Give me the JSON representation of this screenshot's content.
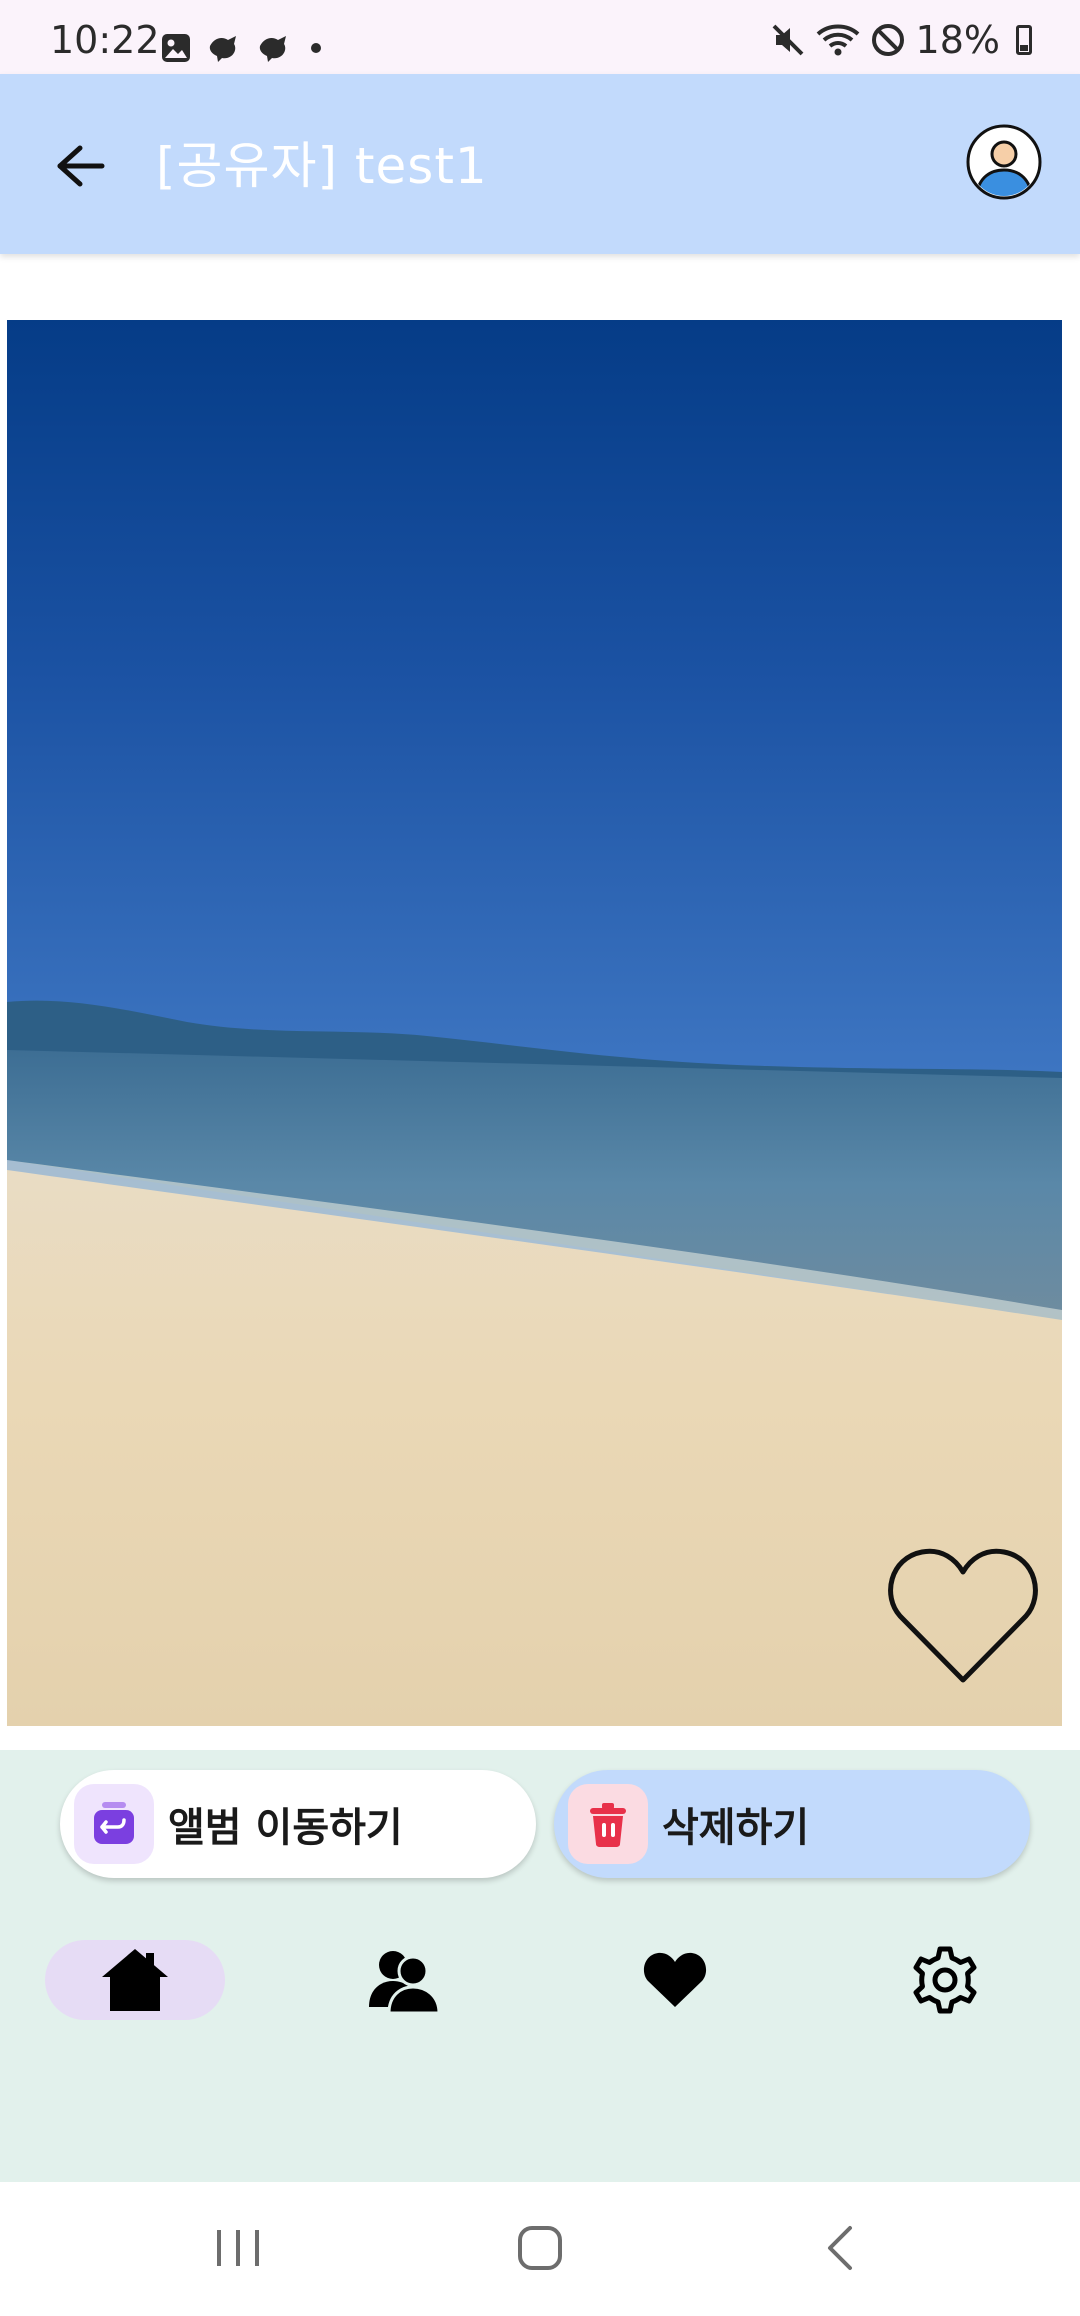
{
  "status_bar": {
    "time": "10:22",
    "battery": "18%",
    "icons_left": [
      "gallery-icon",
      "bird-icon",
      "bird-icon",
      "dot-icon"
    ],
    "icons_right": [
      "mute-icon",
      "wifi-icon",
      "do-not-disturb-icon",
      "battery-icon"
    ]
  },
  "app_bar": {
    "title": "[공유자] test1",
    "back_icon": "arrow-back-icon",
    "avatar_icon": "profile-icon"
  },
  "photo": {
    "description_icon": "heart-outline-icon"
  },
  "actions": {
    "move_label": "앨범 이동하기",
    "delete_label": "삭제하기"
  },
  "bottom_nav": {
    "items": [
      {
        "icon": "home-icon",
        "selected": true
      },
      {
        "icon": "friends-icon",
        "selected": false
      },
      {
        "icon": "favorite-icon",
        "selected": false
      },
      {
        "icon": "settings-icon",
        "selected": false
      }
    ]
  },
  "colors": {
    "app_bar": "#c2dafc",
    "action_area": "#e2f1ec",
    "nav_selected": "#e6dcf5",
    "move_icon_bg": "#efe4fd",
    "delete_icon_bg": "#fbdbe2"
  }
}
